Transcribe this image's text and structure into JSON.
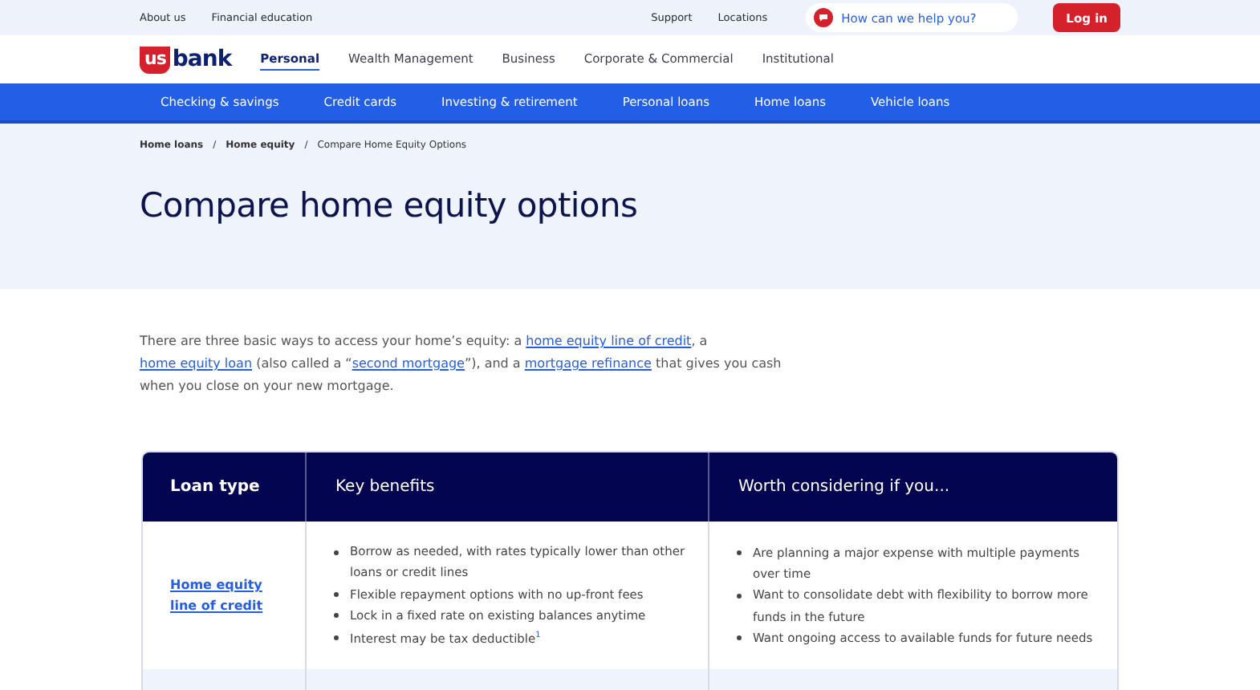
{
  "utility_bar": {
    "links": [
      "About us",
      "Financial education"
    ],
    "right_links": [
      "Support",
      "Locations"
    ],
    "search": {
      "placeholder": "How can we help you?"
    },
    "login_button": "Log in"
  },
  "logo": {
    "mark": "us",
    "word": "bank"
  },
  "main_nav": [
    {
      "label": "Personal",
      "selected": true
    },
    {
      "label": "Wealth Management",
      "selected": false
    },
    {
      "label": "Business",
      "selected": false
    },
    {
      "label": "Corporate & Commercial",
      "selected": false
    },
    {
      "label": "Institutional",
      "selected": false
    }
  ],
  "sub_nav": [
    "Checking & savings",
    "Credit cards",
    "Investing & retirement",
    "Personal loans",
    "Home loans",
    "Vehicle loans"
  ],
  "breadcrumb_separator": "/",
  "breadcrumb": [
    {
      "label": "Home loans",
      "kind": "link"
    },
    {
      "label": "Home equity",
      "kind": "link"
    },
    {
      "label": "Compare Home Equity Options",
      "kind": "current"
    }
  ],
  "title": "Compare home equity options",
  "intro": [
    {
      "kind": "text",
      "text": "There are three basic ways to access your home’s equity: a "
    },
    {
      "kind": "link",
      "text": "home equity line of credit"
    },
    {
      "kind": "text",
      "text": ", a "
    },
    {
      "kind": "link",
      "text": "home equity loan"
    },
    {
      "kind": "text",
      "text": " (also called a “"
    },
    {
      "kind": "link",
      "text": "second mortgage"
    },
    {
      "kind": "text",
      "text": "”), and a "
    },
    {
      "kind": "link",
      "text": "mortgage refinance"
    },
    {
      "kind": "text",
      "text": " that gives you cash when you close on your new mortgage."
    }
  ],
  "table": {
    "columns": [
      "Loan type",
      "Key benefits",
      "Worth considering if you..."
    ],
    "rows": [
      {
        "loan_type": "Home equity line of credit",
        "benefits": [
          "Borrow as needed, with rates typically lower than other loans or credit lines",
          "Flexible repayment options with no up-front fees",
          "Lock in a fixed rate on existing balances anytime",
          "Interest may be tax deductible$^{1}$"
        ],
        "considering": [
          "Are planning a major expense with multiple payments over time",
          "Want to consolidate debt with flexibility to borrow more funds in the future",
          "Want ongoing access to available funds for future needs"
        ]
      }
    ]
  }
}
